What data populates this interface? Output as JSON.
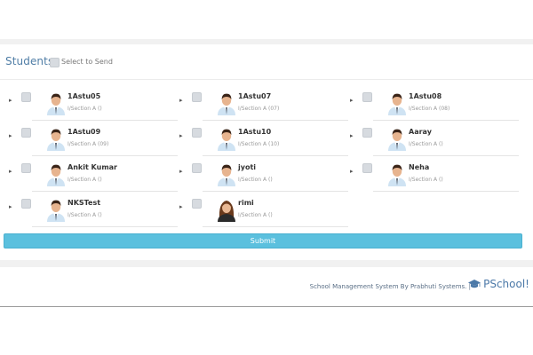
{
  "students_panel": {
    "title": "Students",
    "select_to_send_label": "Select to Send",
    "submit_label": "Submit"
  },
  "students": [
    {
      "name": "1Astu05",
      "section": "I/Section A ()",
      "avatar": "male-student-avatar-icon"
    },
    {
      "name": "1Astu07",
      "section": "I/Section A (07)",
      "avatar": "male-student-avatar-icon"
    },
    {
      "name": "1Astu08",
      "section": "I/Section A (08)",
      "avatar": "male-student-avatar-icon"
    },
    {
      "name": "1Astu09",
      "section": "I/Section A (09)",
      "avatar": "male-student-avatar-icon"
    },
    {
      "name": "1Astu10",
      "section": "I/Section A (10)",
      "avatar": "male-student-avatar-icon"
    },
    {
      "name": "Aaray",
      "section": "I/Section A ()",
      "avatar": "male-student-avatar-icon"
    },
    {
      "name": "Ankit Kumar",
      "section": "I/Section A ()",
      "avatar": "male-student-avatar-icon"
    },
    {
      "name": "jyoti",
      "section": "I/Section A ()",
      "avatar": "male-student-avatar-icon"
    },
    {
      "name": "Neha",
      "section": "I/Section A ()",
      "avatar": "male-student-avatar-icon"
    },
    {
      "name": "NKSTest",
      "section": "I/Section A ()",
      "avatar": "male-student-avatar-icon"
    },
    {
      "name": "rimi",
      "section": "I/Section A ()",
      "avatar": "female-student-avatar-icon"
    }
  ],
  "footer": {
    "credit_text": "School Management System By Prabhuti Systems. |",
    "brand_name": "PSchool!",
    "brand_icon": "graduation-cap-icon"
  },
  "colors": {
    "accent": "#5bc0de",
    "title_blue": "#4f7da6",
    "brand_blue": "#4c79a8"
  }
}
